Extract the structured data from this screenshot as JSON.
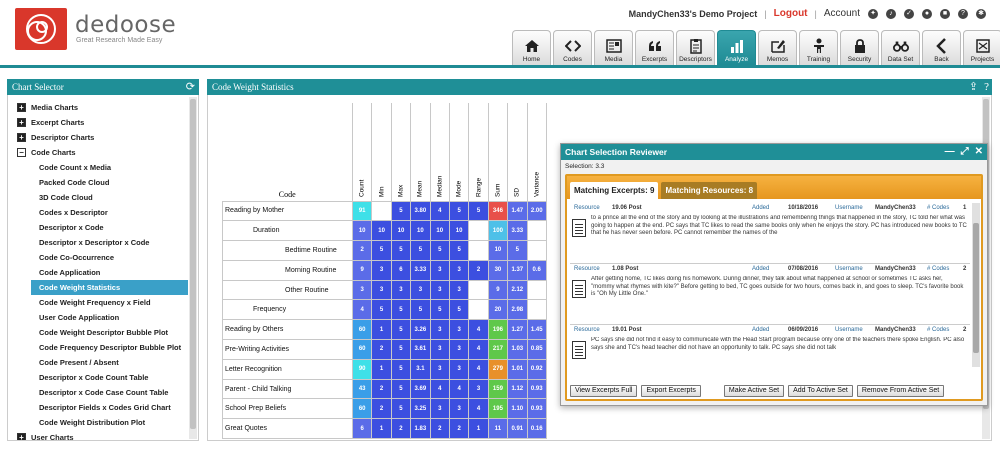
{
  "header": {
    "brand": "dedoose",
    "tagline": "Great Research Made Easy",
    "project": "MandyChen33's Demo Project",
    "logout": "Logout",
    "account": "Account"
  },
  "nav": [
    {
      "label": "Home",
      "icon": "home-icon"
    },
    {
      "label": "Codes",
      "icon": "code-icon"
    },
    {
      "label": "Media",
      "icon": "media-icon"
    },
    {
      "label": "Excerpts",
      "icon": "quote-icon"
    },
    {
      "label": "Descriptors",
      "icon": "clipboard-icon"
    },
    {
      "label": "Analyze",
      "icon": "bar-chart-icon"
    },
    {
      "label": "Memos",
      "icon": "memo-icon"
    },
    {
      "label": "Training",
      "icon": "person-icon"
    },
    {
      "label": "Security",
      "icon": "lock-icon"
    },
    {
      "label": "Data Set",
      "icon": "binoculars-icon"
    },
    {
      "label": "Back",
      "icon": "back-arrow-icon"
    },
    {
      "label": "Projects",
      "icon": "projects-icon"
    }
  ],
  "selector": {
    "title": "Chart Selector",
    "groups": [
      {
        "label": "Media Charts",
        "expanded": false
      },
      {
        "label": "Excerpt Charts",
        "expanded": false
      },
      {
        "label": "Descriptor Charts",
        "expanded": false
      },
      {
        "label": "Code Charts",
        "expanded": true
      }
    ],
    "items": [
      "Code Count x Media",
      "Packed Code Cloud",
      "3D Code Cloud",
      "Codes x Descriptor",
      "Descriptor x Code",
      "Descriptor x Descriptor x Code",
      "Code Co-Occurrence",
      "Code Application",
      "Code Weight Statistics",
      "Code Weight Frequency x Field",
      "User Code Application",
      "Code Weight Descriptor Bubble Plot",
      "Code Frequency Descriptor Bubble Plot",
      "Code Present / Absent",
      "Descriptor x Code Count Table",
      "Descriptor x Code Case Count Table",
      "Descriptor Fields x Codes Grid Chart",
      "Code Weight Distribution Plot"
    ],
    "trailing_group": "User Charts"
  },
  "stats": {
    "title": "Code Weight Statistics",
    "code_header": "Code",
    "columns": [
      "Count",
      "Min",
      "Max",
      "Mean",
      "Median",
      "Mode",
      "Range",
      "Sum",
      "SD",
      "Variance"
    ],
    "rows": [
      {
        "code": "Reading by Mother",
        "level": 0,
        "values": [
          "91",
          "",
          "5",
          "3.80",
          "4",
          "5",
          "5",
          "346",
          "1.47",
          "2.00"
        ]
      },
      {
        "code": "Duration",
        "level": 1,
        "values": [
          "10",
          "10",
          "10",
          "10",
          "10",
          "10",
          "",
          "100",
          "3.33",
          ""
        ]
      },
      {
        "code": "Bedtime Routine",
        "level": 2,
        "values": [
          "2",
          "5",
          "5",
          "5",
          "5",
          "5",
          "",
          "10",
          "5",
          ""
        ]
      },
      {
        "code": "Morning Routine",
        "level": 2,
        "values": [
          "9",
          "3",
          "6",
          "3.33",
          "3",
          "3",
          "2",
          "30",
          "1.37",
          "0.6"
        ]
      },
      {
        "code": "Other Routine",
        "level": 2,
        "values": [
          "3",
          "3",
          "3",
          "3",
          "3",
          "3",
          "",
          "9",
          "2.12",
          ""
        ]
      },
      {
        "code": "Frequency",
        "level": 1,
        "values": [
          "4",
          "5",
          "5",
          "5",
          "5",
          "5",
          "",
          "20",
          "2.98",
          ""
        ]
      },
      {
        "code": "Reading by Others",
        "level": 0,
        "values": [
          "60",
          "1",
          "5",
          "3.26",
          "3",
          "3",
          "4",
          "196",
          "1.27",
          "1.45"
        ]
      },
      {
        "code": "Pre-Writing Activities",
        "level": 0,
        "values": [
          "60",
          "2",
          "5",
          "3.61",
          "3",
          "3",
          "4",
          "217",
          "1.03",
          "0.85"
        ]
      },
      {
        "code": "Letter Recognition",
        "level": 0,
        "values": [
          "90",
          "1",
          "5",
          "3.1",
          "3",
          "3",
          "4",
          "279",
          "1.01",
          "0.92"
        ]
      },
      {
        "code": "Parent - Child Talking",
        "level": 0,
        "values": [
          "43",
          "2",
          "5",
          "3.69",
          "4",
          "4",
          "3",
          "159",
          "1.12",
          "0.93"
        ]
      },
      {
        "code": "School Prep Beliefs",
        "level": 0,
        "values": [
          "60",
          "2",
          "5",
          "3.25",
          "3",
          "3",
          "4",
          "195",
          "1.10",
          "0.93"
        ]
      },
      {
        "code": "Great Quotes",
        "level": 0,
        "values": [
          "6",
          "1",
          "2",
          "1.83",
          "2",
          "2",
          "1",
          "11",
          "0.91",
          "0.16"
        ]
      }
    ],
    "cell_colors": {
      "count_hi": "#3ee0e8",
      "count": "#3a9ee8",
      "blue": "#3c4fe0",
      "blue_light": "#5b6ce8",
      "sum_hi": "#e8504a",
      "sum_mid": "#5fc84a",
      "sum_orange": "#e8902a",
      "sum_light": "#4ec0e8"
    }
  },
  "reviewer": {
    "title": "Chart Selection Reviewer",
    "selection": "Selection: 3.3",
    "tab_excerpts": "Matching Excerpts: 9",
    "tab_resources": "Matching Resources: 8",
    "excerpts": [
      {
        "resource_label": "Resource",
        "resource": "19.06 Post",
        "added_label": "Added",
        "added": "10/18/2016",
        "user_label": "Username",
        "user": "MandyChen33",
        "codes_label": "# Codes",
        "codes": "1",
        "text": "to a prince all the end of the story and by looking at the illustrations and remembering things that happened in the story, TC told her what was going to happen at the end. PC says that TC likes to read the same books only when he enjoys the story. PC has introduced new books to TC that he has never seen before. PC cannot remember the names of the"
      },
      {
        "resource_label": "Resource",
        "resource": "1.08 Post",
        "added_label": "Added",
        "added": "07/08/2016",
        "user_label": "Username",
        "user": "MandyChen33",
        "codes_label": "# Codes",
        "codes": "2",
        "text": "After getting home, TC likes doing his homework. During dinner, they talk about what happened at school or sometimes TC asks her, \"mommy what rhymes with kite?\" Before getting to bed, TC goes outside for two hours, comes back in, and goes to sleep. TC's favorite book is \"Oh My Little One.\""
      },
      {
        "resource_label": "Resource",
        "resource": "19.01 Post",
        "added_label": "Added",
        "added": "06/09/2016",
        "user_label": "Username",
        "user": "MandyChen33",
        "codes_label": "# Codes",
        "codes": "2",
        "text": "PC says she did not find it easy to communicate with the Head Start program because only one of the teachers there spoke English. PC also says she and TC's head teacher did not have an opportunity to talk. PC says she did not talk"
      }
    ],
    "buttons": [
      "View Excerpts Full",
      "Export Excerpts",
      "Make Active Set",
      "Add To Active Set",
      "Remove From Active Set"
    ]
  },
  "colors": {
    "teal": "#1f8f97",
    "brand_red": "#d9372b",
    "orange": "#e6961f",
    "selected_item": "#3aa0c8"
  }
}
